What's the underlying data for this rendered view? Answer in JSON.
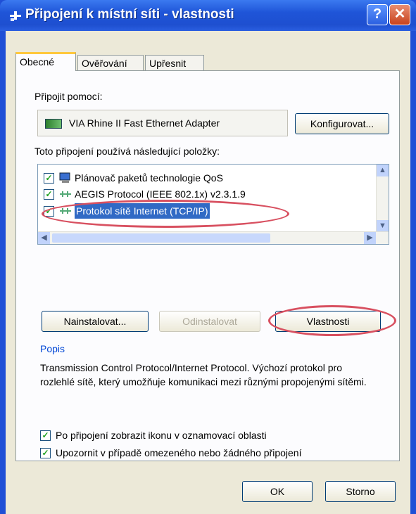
{
  "window": {
    "title": "Připojení k místní síti - vlastnosti",
    "help_label": "?",
    "close_label": "✕"
  },
  "tabs": [
    {
      "label": "Obecné",
      "active": true
    },
    {
      "label": "Ověřování",
      "active": false
    },
    {
      "label": "Upřesnit",
      "active": false
    }
  ],
  "connect_using": {
    "label": "Připojit pomocí:",
    "adapter_name": "VIA Rhine II Fast Ethernet Adapter",
    "configure_button": "Konfigurovat..."
  },
  "components": {
    "label": "Toto připojení používá následující položky:",
    "items": [
      {
        "label": "Plánovač paketů technologie QoS",
        "checked": true,
        "icon": "qos-scheduler-icon"
      },
      {
        "label": "AEGIS Protocol (IEEE 802.1x) v2.3.1.9",
        "checked": true,
        "icon": "network-protocol-icon"
      },
      {
        "label": "Protokol sítě Internet (TCP/IP)",
        "checked": true,
        "selected": true,
        "icon": "network-protocol-icon"
      }
    ]
  },
  "buttons": {
    "install": "Nainstalovat...",
    "uninstall": "Odinstalovat",
    "properties": "Vlastnosti",
    "ok": "OK",
    "cancel": "Storno"
  },
  "description": {
    "title": "Popis",
    "text": "Transmission Control Protocol/Internet Protocol. Výchozí protokol pro rozlehlé sítě, který umožňuje komunikaci mezi různými propojenými sítěmi."
  },
  "options": {
    "show_icon": {
      "label": "Po připojení zobrazit ikonu v oznamovací oblasti",
      "checked": true
    },
    "notify": {
      "label": "Upozornit v případě omezeného nebo žádného připojení",
      "checked": true
    }
  },
  "colors": {
    "titlebar": "#1f55d8",
    "selection": "#316ac5",
    "annotation_circle": "#d85060",
    "group_title": "#0046d5"
  }
}
